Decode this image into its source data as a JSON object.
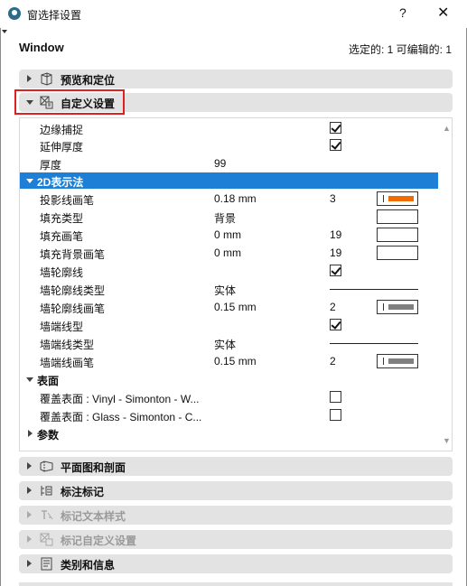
{
  "titlebar": {
    "title": "窗选择设置",
    "help": "?",
    "close": "✕"
  },
  "header": {
    "title": "Window",
    "status": "选定的: 1 可编辑的: 1"
  },
  "panels": [
    {
      "label": "预览和定位",
      "icon": "preview-icon"
    },
    {
      "label": "自定义设置",
      "icon": "custom-settings-icon"
    },
    {
      "label": "平面图和剖面",
      "icon": "floor-plan-icon"
    },
    {
      "label": "标注标记",
      "icon": "dimension-marker-icon"
    },
    {
      "label": "标记文本样式",
      "icon": "marker-text-style-icon"
    },
    {
      "label": "标记自定义设置",
      "icon": "marker-custom-settings-icon"
    },
    {
      "label": "类别和信息",
      "icon": "category-info-icon"
    }
  ],
  "rows": {
    "edge_snap": {
      "label": "边缘捕捉"
    },
    "extend_thickness": {
      "label": "延伸厚度"
    },
    "thickness": {
      "label": "厚度",
      "value": "99"
    },
    "section_2d": {
      "label": "2D表示法"
    },
    "proj_pen": {
      "label": "投影线画笔",
      "value": "0.18 mm",
      "num": "3",
      "color": "#f26b00"
    },
    "fill_type": {
      "label": "填充类型",
      "value": "背景"
    },
    "fill_pen": {
      "label": "填充画笔",
      "value": "0 mm",
      "num": "19"
    },
    "fill_bg_pen": {
      "label": "填充背景画笔",
      "value": "0 mm",
      "num": "19"
    },
    "wall_contour": {
      "label": "墙轮廓线"
    },
    "wall_contour_type": {
      "label": "墙轮廓线类型",
      "value": "实体"
    },
    "wall_contour_pen": {
      "label": "墙轮廓线画笔",
      "value": "0.15 mm",
      "num": "2",
      "color": "#808080"
    },
    "wall_end_type": {
      "label": "墙端线型"
    },
    "wall_end_linetype": {
      "label": "墙端线类型",
      "value": "实体"
    },
    "wall_end_pen": {
      "label": "墙端线画笔",
      "value": "0.15 mm",
      "num": "2",
      "color": "#808080"
    },
    "section_surface": {
      "label": "表面"
    },
    "surface_vinyl": {
      "label": "覆盖表面 : Vinyl - Simonton - W..."
    },
    "surface_glass": {
      "label": "覆盖表面 : Glass - Simonton - C..."
    },
    "section_params": {
      "label": "参数"
    }
  },
  "scroll": {
    "up": "▲",
    "down": "▼"
  }
}
